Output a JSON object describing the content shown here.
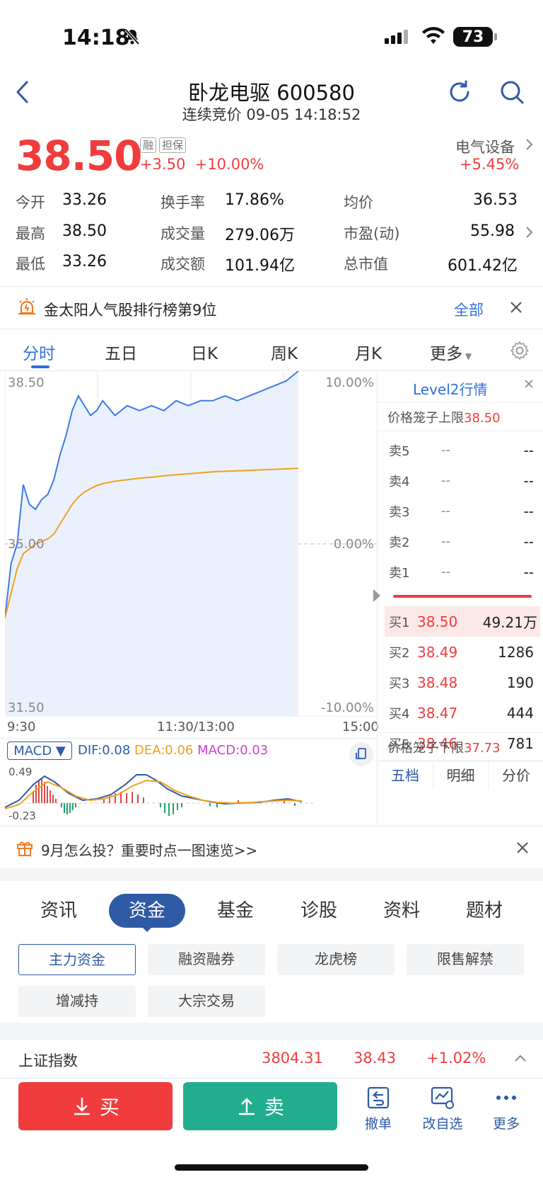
{
  "status_bar": {
    "time": "14:18",
    "battery": "73"
  },
  "header": {
    "title": "卧龙电驱 600580",
    "subtitle": "连续竞价 09-05 14:18:52"
  },
  "quote": {
    "price": "38.50",
    "tags": [
      "融",
      "担保"
    ],
    "change": "+3.50",
    "change_pct": "+10.00%",
    "sector_name": "电气设备",
    "sector_pct": "+5.45%"
  },
  "stats": [
    [
      {
        "label": "今开",
        "value": "33.26",
        "color": "green"
      },
      {
        "label": "换手率",
        "value": "17.86%"
      },
      {
        "label": "均价",
        "value": "36.53",
        "color": "red"
      }
    ],
    [
      {
        "label": "最高",
        "value": "38.50",
        "color": "red"
      },
      {
        "label": "成交量",
        "value": "279.06万"
      },
      {
        "label": "市盈(动)",
        "value": "55.98"
      }
    ],
    [
      {
        "label": "最低",
        "value": "33.26",
        "color": "green"
      },
      {
        "label": "成交额",
        "value": "101.94亿"
      },
      {
        "label": "总市值",
        "value": "601.42亿"
      }
    ]
  ],
  "banner": {
    "text": "金太阳人气股排行榜第9位",
    "link": "全部"
  },
  "chart_tabs": [
    "分时",
    "五日",
    "日K",
    "周K",
    "月K",
    "更多"
  ],
  "chart": {
    "y_high": "38.50",
    "y_mid": "35.00",
    "y_low": "31.50",
    "pct_high": "10.00%",
    "pct_mid": "0.00%",
    "pct_low": "-10.00%",
    "x_start": "9:30",
    "x_mid": "11:30/13:00",
    "x_end": "15:00"
  },
  "chart_data": {
    "type": "line",
    "title": "",
    "xlabel": "",
    "ylabel": "",
    "ylim": [
      31.5,
      38.5
    ],
    "x": [
      0,
      5,
      10,
      15,
      20,
      25,
      30,
      35,
      40,
      45,
      50,
      55,
      60,
      65,
      70,
      75,
      80,
      90,
      100,
      110,
      120,
      130,
      140,
      150,
      160,
      170,
      180,
      190,
      200,
      210,
      220,
      230,
      240
    ],
    "series": [
      {
        "values": [
          33.5,
          34.6,
          35.0,
          36.2,
          35.8,
          35.7,
          35.9,
          36.0,
          36.3,
          36.8,
          37.2,
          37.7,
          38.0,
          37.8,
          37.6,
          37.7,
          37.9,
          37.6,
          37.8,
          37.7,
          37.8,
          37.7,
          37.9,
          37.8,
          37.9,
          37.9,
          38.0,
          37.9,
          38.0,
          38.1,
          38.2,
          38.3,
          38.5
        ]
      },
      {
        "values": [
          33.5,
          34.0,
          34.5,
          34.8,
          34.9,
          35.0,
          35.05,
          35.1,
          35.2,
          35.4,
          35.6,
          35.8,
          35.95,
          36.05,
          36.12,
          36.18,
          36.22,
          36.27,
          36.3,
          36.33,
          36.35,
          36.38,
          36.4,
          36.42,
          36.44,
          36.46,
          36.47,
          36.48,
          36.49,
          36.5,
          36.51,
          36.52,
          36.53
        ]
      }
    ]
  },
  "macd": {
    "selector": "MACD",
    "dif": "DIF:0.08",
    "dea": "DEA:0.06",
    "macd": "MACD:0.03",
    "y_high": "0.49",
    "y_low": "-0.23"
  },
  "level2": {
    "title": "Level2行情",
    "upper_limit_label": "价格笼子上限",
    "upper_limit": "38.50",
    "lower_limit_label": "价格笼子下限",
    "lower_limit": "37.73",
    "sells": [
      {
        "label": "卖5",
        "price": "--",
        "vol": "--"
      },
      {
        "label": "卖4",
        "price": "--",
        "vol": "--"
      },
      {
        "label": "卖3",
        "price": "--",
        "vol": "--"
      },
      {
        "label": "卖2",
        "price": "--",
        "vol": "--"
      },
      {
        "label": "卖1",
        "price": "--",
        "vol": "--"
      }
    ],
    "buys": [
      {
        "label": "买1",
        "price": "38.50",
        "vol": "49.21万"
      },
      {
        "label": "买2",
        "price": "38.49",
        "vol": "1286"
      },
      {
        "label": "买3",
        "price": "38.48",
        "vol": "190"
      },
      {
        "label": "买4",
        "price": "38.47",
        "vol": "444"
      },
      {
        "label": "买5",
        "price": "38.46",
        "vol": "781"
      }
    ],
    "tabs": [
      "五档",
      "明细",
      "分价"
    ]
  },
  "notice": {
    "text": "9月怎么投？重要时点一图速览>>"
  },
  "section_tabs": [
    "资讯",
    "资金",
    "基金",
    "诊股",
    "资料",
    "题材"
  ],
  "chips": [
    "主力资金",
    "融资融券",
    "龙虎榜",
    "限售解禁",
    "增减持",
    "大宗交易"
  ],
  "index_bar": {
    "name": "上证指数",
    "value": "3804.31",
    "change": "38.43",
    "pct": "+1.02%"
  },
  "actions": {
    "buy": "买",
    "sell": "卖",
    "cancel": "撤单",
    "watchlist": "改自选",
    "more": "更多"
  }
}
